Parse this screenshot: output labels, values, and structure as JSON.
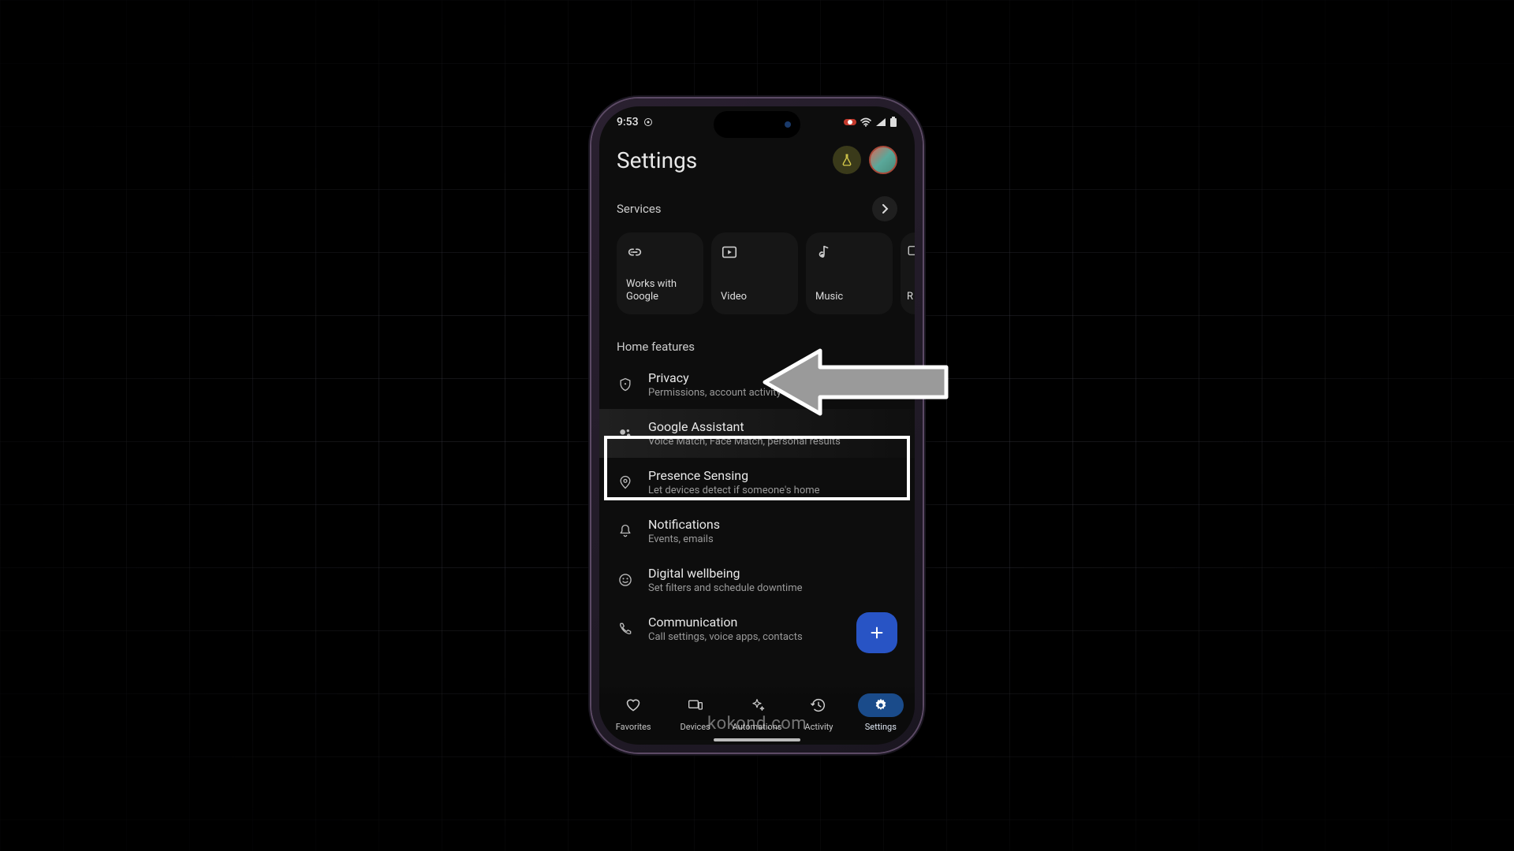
{
  "status": {
    "time": "9:53",
    "recording": true
  },
  "header": {
    "title": "Settings"
  },
  "services": {
    "label": "Services",
    "cards": [
      {
        "label": "Works with Google"
      },
      {
        "label": "Video"
      },
      {
        "label": "Music"
      },
      {
        "label": "R"
      }
    ]
  },
  "home_features": {
    "label": "Home features",
    "items": [
      {
        "title": "Privacy",
        "sub": "Permissions, account activity & data"
      },
      {
        "title": "Google Assistant",
        "sub": "Voice Match, Face Match, personal results"
      },
      {
        "title": "Presence Sensing",
        "sub": "Let devices detect if someone's home"
      },
      {
        "title": "Notifications",
        "sub": "Events, emails"
      },
      {
        "title": "Digital wellbeing",
        "sub": "Set filters and schedule downtime"
      },
      {
        "title": "Communication",
        "sub": "Call settings, voice apps, contacts"
      }
    ]
  },
  "nav": {
    "items": [
      {
        "label": "Favorites"
      },
      {
        "label": "Devices"
      },
      {
        "label": "Automations"
      },
      {
        "label": "Activity"
      },
      {
        "label": "Settings"
      }
    ],
    "active_index": 4
  },
  "watermark": "kokond.com",
  "colors": {
    "accent": "#2854c5",
    "nav_active": "#1a4b8a",
    "highlight": "#ffffff"
  }
}
